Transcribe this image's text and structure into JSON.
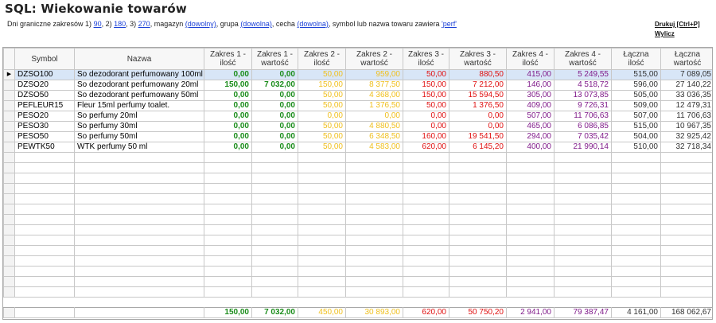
{
  "title": "SQL: Wiekowanie towarów",
  "filter": {
    "prefix": "Dni graniczne zakresów 1)",
    "d1": "90",
    "sep2": ", 2)",
    "d2": "180",
    "sep3": ", 3)",
    "d3": "270",
    "mag_label": ", magazyn",
    "magazyn": "(dowolny)",
    "grp_label": ", grupa",
    "grupa": "(dowolna)",
    "cecha_label": ", cecha",
    "cecha": "(dowolna)",
    "sym_label": ", symbol lub nazwa towaru zawiera",
    "symbol": "'perf'"
  },
  "actions": {
    "print": "Drukuj [Ctrl+P]",
    "calc": "Wylicz"
  },
  "columns": [
    "Symbol",
    "Nazwa",
    "Zakres 1 - ilość",
    "Zakres 1 - wartość",
    "Zakres 2 - ilość",
    "Zakres 2 - wartość",
    "Zakres 3 - ilość",
    "Zakres 3 - wartość",
    "Zakres 4 - ilość",
    "Zakres 4 - wartość",
    "Łączna ilość",
    "Łączna wartość"
  ],
  "rows": [
    [
      "DZSO100",
      "So dezodorant perfumowany 100ml",
      "0,00",
      "0,00",
      "50,00",
      "959,00",
      "50,00",
      "880,50",
      "415,00",
      "5 249,55",
      "515,00",
      "7 089,05"
    ],
    [
      "DZSO20",
      "So dezodorant perfumowany 20ml",
      "150,00",
      "7 032,00",
      "150,00",
      "8 377,50",
      "150,00",
      "7 212,00",
      "146,00",
      "4 518,72",
      "596,00",
      "27 140,22"
    ],
    [
      "DZSO50",
      "So dezodorant perfumowany 50ml",
      "0,00",
      "0,00",
      "50,00",
      "4 368,00",
      "150,00",
      "15 594,50",
      "305,00",
      "13 073,85",
      "505,00",
      "33 036,35"
    ],
    [
      "PEFLEUR15",
      "Fleur 15ml perfumy toalet.",
      "0,00",
      "0,00",
      "50,00",
      "1 376,50",
      "50,00",
      "1 376,50",
      "409,00",
      "9 726,31",
      "509,00",
      "12 479,31"
    ],
    [
      "PESO20",
      "So perfumy 20ml",
      "0,00",
      "0,00",
      "0,00",
      "0,00",
      "0,00",
      "0,00",
      "507,00",
      "11 706,63",
      "507,00",
      "11 706,63"
    ],
    [
      "PESO30",
      "So perfumy 30ml",
      "0,00",
      "0,00",
      "50,00",
      "4 880,50",
      "0,00",
      "0,00",
      "465,00",
      "6 086,85",
      "515,00",
      "10 967,35"
    ],
    [
      "PESO50",
      "So perfumy 50ml",
      "0,00",
      "0,00",
      "50,00",
      "6 348,50",
      "160,00",
      "19 541,50",
      "294,00",
      "7 035,42",
      "504,00",
      "32 925,42"
    ],
    [
      "PEWTK50",
      "WTK perfumy 50 ml",
      "0,00",
      "0,00",
      "50,00",
      "4 583,00",
      "620,00",
      "6 145,20",
      "400,00",
      "21 990,14",
      "510,00",
      "32 718,34"
    ]
  ],
  "totals": [
    "",
    "",
    "150,00",
    "7 032,00",
    "450,00",
    "30 893,00",
    "620,00",
    "50 750,20",
    "2 941,00",
    "79 387,47",
    "4 161,00",
    "168 062,67"
  ],
  "colors": {
    "range1": "#1a8c1a",
    "range2": "#f0c01f",
    "range3": "#e01010",
    "range4": "#801b8a",
    "selected_row": "#d8e6f7"
  },
  "icons": {
    "current_row": "triangle-right-icon"
  }
}
